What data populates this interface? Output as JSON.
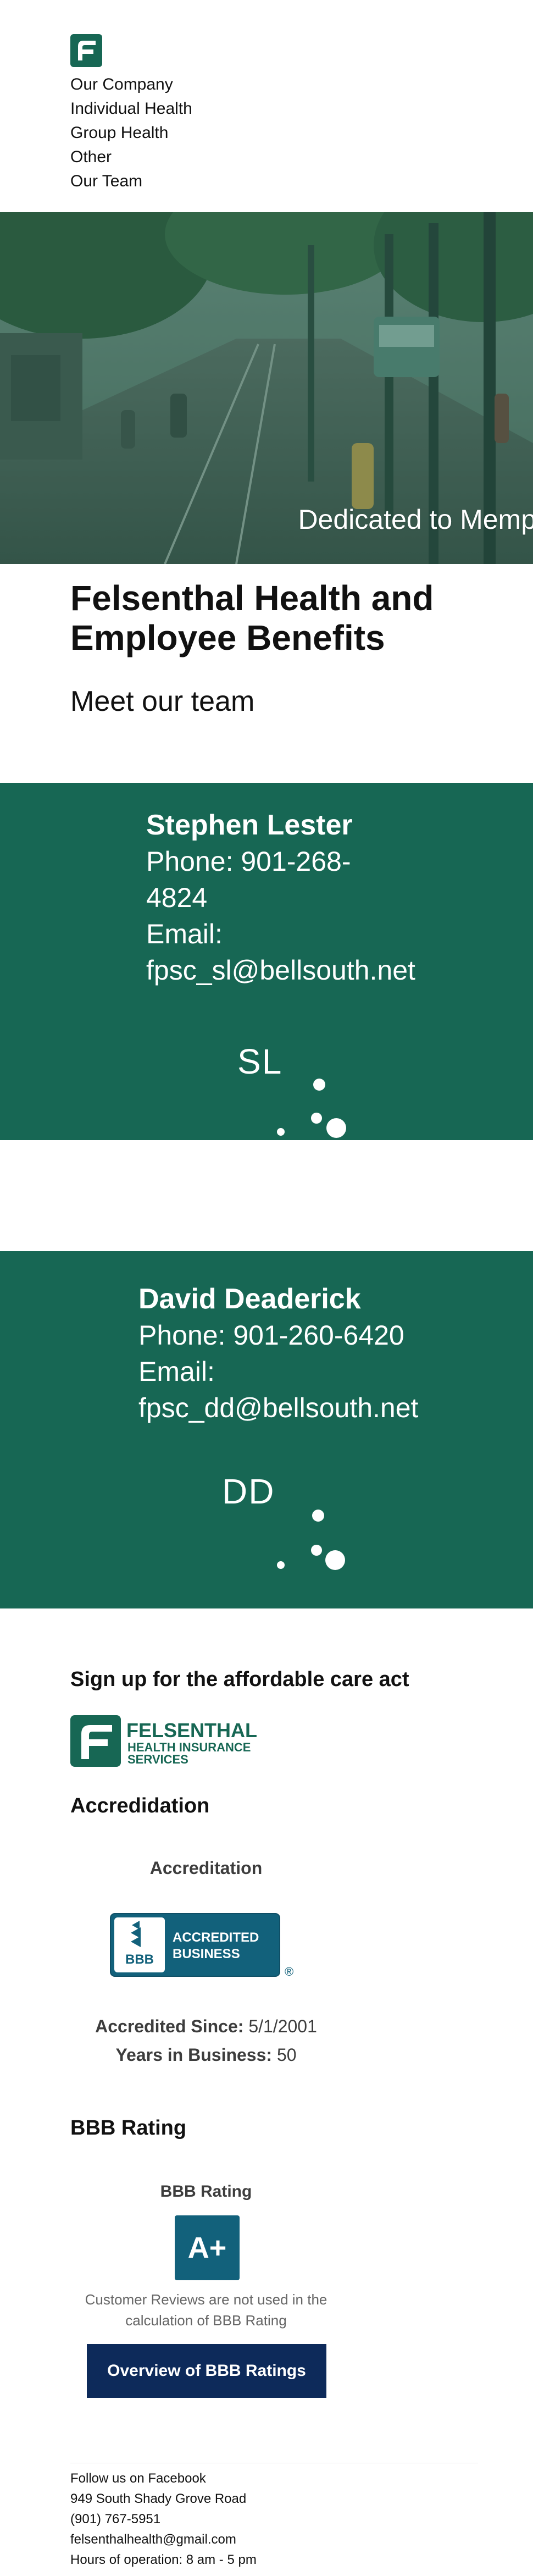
{
  "header": {
    "logo_icon": "felsenthal-f-logo-icon",
    "nav": [
      "Our Company",
      "Individual Health",
      "Group Health",
      "Other",
      "Our Team"
    ]
  },
  "hero": {
    "caption": "Dedicated to Memp",
    "image": "street-with-trolley-photo"
  },
  "intro": {
    "title": "Felsenthal Health and Employee Benefits",
    "subtitle": "Meet our team"
  },
  "team": [
    {
      "name": "Stephen Lester",
      "phone_lines": [
        "Phone: 901-268-",
        "4824"
      ],
      "email_label": "Email:",
      "email": "fpsc_sl@bellsouth.net",
      "initials": "SL"
    },
    {
      "name": "David Deaderick",
      "phone": "Phone: 901-260-6420",
      "email_label": "Email:",
      "email": "fpsc_dd@bellsouth.net",
      "initials": "DD"
    }
  ],
  "aca": {
    "heading": "Sign up for the affordable care act",
    "logo": {
      "word1": "FELSENTHAL",
      "word2": "HEALTH INSURANCE",
      "word3": "SERVICES"
    }
  },
  "accreditation": {
    "heading": "Accredidation",
    "widget_title": "Accreditation",
    "badge": {
      "abbr": "BBB",
      "line1": "ACCREDITED",
      "line2": "BUSINESS"
    },
    "since_label": "Accredited Since:",
    "since_value": "5/1/2001",
    "years_label": "Years in Business:",
    "years_value": "50"
  },
  "rating": {
    "heading": "BBB Rating",
    "widget_title": "BBB Rating",
    "grade": "A+",
    "note": "Customer Reviews are not used in the calculation of BBB Rating",
    "button": "Overview of BBB Ratings"
  },
  "footer": [
    "Follow us on Facebook",
    "949 South Shady Grove Road",
    "(901) 767-5951",
    "felsenthalhealth@gmail.com",
    "Hours of operation: 8 am - 5 pm"
  ],
  "colors": {
    "brand_green": "#176754",
    "bbb_blue": "#12617b",
    "button_navy": "#0d2a5a"
  }
}
